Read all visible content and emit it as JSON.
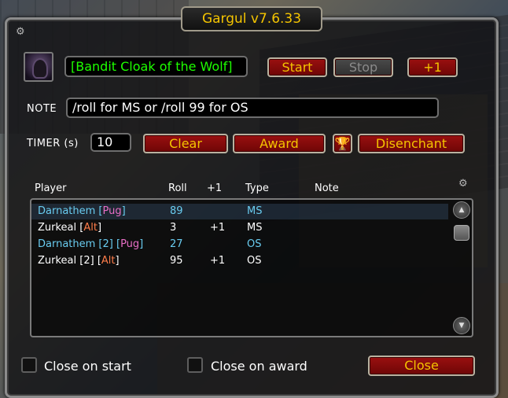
{
  "window": {
    "title": "Gargul v7.6.33"
  },
  "item": {
    "name": "[Bandit Cloak of the Wolf]",
    "quality_color": "#1eff00"
  },
  "buttons": {
    "start": "Start",
    "stop": "Stop",
    "plus_one": "+1",
    "clear": "Clear",
    "award": "Award",
    "disenchant": "Disenchant",
    "close": "Close"
  },
  "note": {
    "label": "NOTE",
    "value": "/roll for MS or /roll 99 for OS"
  },
  "timer": {
    "label": "TIMER (s)",
    "value": "10"
  },
  "table": {
    "headers": {
      "player": "Player",
      "roll": "Roll",
      "plus_one": "+1",
      "type": "Type",
      "note": "Note"
    },
    "rows": [
      {
        "name": "Darnathem",
        "tag": "Pug",
        "roll": "89",
        "plus_one": "",
        "type": "MS",
        "color": "blue"
      },
      {
        "name": "Zurkeal",
        "tag": "Alt",
        "roll": "3",
        "plus_one": "+1",
        "type": "MS",
        "color": "white"
      },
      {
        "name": "Darnathem [2]",
        "tag": "Pug",
        "roll": "27",
        "plus_one": "",
        "type": "OS",
        "color": "blue"
      },
      {
        "name": "Zurkeal [2]",
        "tag": "Alt",
        "roll": "95",
        "plus_one": "+1",
        "type": "OS",
        "color": "white"
      }
    ]
  },
  "options": {
    "close_on_start": "Close on start",
    "close_on_award": "Close on award"
  },
  "icons": {
    "settings": "gear-icon",
    "trophy": "trophy-icon",
    "item": "cloak-icon"
  },
  "colors": {
    "button_red": "#9a1010",
    "title_gold": "#f4c400",
    "class_blue": "#69ccf0"
  }
}
